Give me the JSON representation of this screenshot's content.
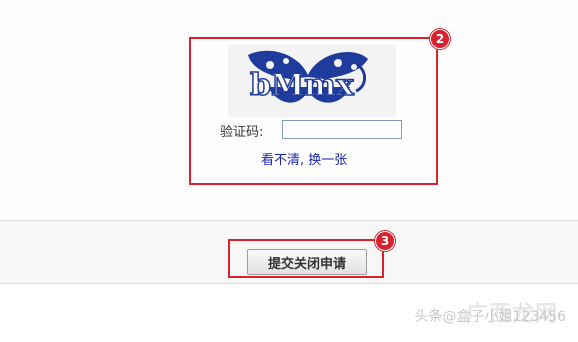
{
  "badges": {
    "captcha_step": "2",
    "submit_step": "3"
  },
  "captcha": {
    "image_text": "bMmx",
    "label": "验证码:",
    "input_value": "",
    "refresh_link": "看不清, 换一张"
  },
  "actions": {
    "submit_label": "提交关闭申请"
  },
  "watermark": {
    "text": "头条@盒子小姐123456",
    "logo_text": "广西龙网"
  },
  "colors": {
    "highlight": "#d8232f",
    "link": "#1a26b0",
    "captcha_ink": "#1f3c9c"
  }
}
